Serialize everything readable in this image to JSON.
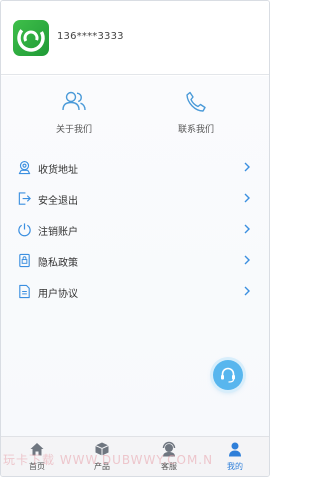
{
  "profile": {
    "phone": "136****3333"
  },
  "quick_links": {
    "about": "关于我们",
    "contact": "联系我们"
  },
  "menu": {
    "items": [
      {
        "label": "收货地址",
        "icon": "location-icon"
      },
      {
        "label": "安全退出",
        "icon": "logout-icon"
      },
      {
        "label": "注销账户",
        "icon": "power-icon"
      },
      {
        "label": "隐私政策",
        "icon": "privacy-icon"
      },
      {
        "label": "用户协议",
        "icon": "agreement-icon"
      }
    ]
  },
  "tabbar": {
    "home": "首页",
    "product": "产品",
    "service": "客服",
    "mine": "我的"
  },
  "watermark": "玩卡下载 WWW.DUBWWY.COM.N",
  "colors": {
    "accent": "#3b8fe0",
    "icon_blue": "#4a9ad8",
    "fab": "#58b6ee",
    "logo_green": "#2fae40"
  }
}
